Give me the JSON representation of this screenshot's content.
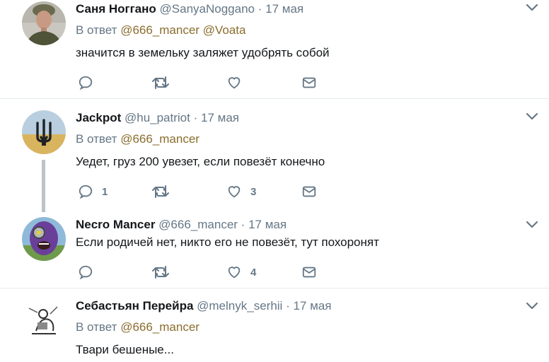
{
  "tweets": [
    {
      "name": "Саня Ногганo",
      "handle": "@SanyaNoggano",
      "sep": "·",
      "date": "17 мая",
      "reply_prefix": "В ответ",
      "reply_mentions": "@666_mancer @Voata",
      "text": "значится в земельку заляжет удобрять собой",
      "reply_count": "",
      "retweet_count": "",
      "like_count": ""
    },
    {
      "name": "Jackpot",
      "handle": "@hu_patriot",
      "sep": "·",
      "date": "17 мая",
      "reply_prefix": "В ответ",
      "reply_mentions": "@666_mancer",
      "text": "Уедет, груз 200 увезет, если повезёт конечно",
      "reply_count": "1",
      "retweet_count": "",
      "like_count": "3"
    },
    {
      "name": "Necro Mancer",
      "handle": "@666_mancer",
      "sep": "·",
      "date": "17 мая",
      "text": "Если родичей нет, никто его не повезёт, тут похоронят",
      "reply_count": "",
      "retweet_count": "",
      "like_count": "4"
    },
    {
      "name": "Себастьян Перейра",
      "handle": "@melnyk_serhii",
      "sep": "·",
      "date": "17 мая",
      "reply_prefix": "В ответ",
      "reply_mentions": "@666_mancer",
      "text": "Твари бешеные..."
    }
  ],
  "colors": {
    "name": "#14171a",
    "meta": "#657786",
    "mention": "#8a6d2e",
    "divider": "#e6ecf0",
    "icon": "#657786"
  },
  "icons": {
    "menu": "chevron-down-icon",
    "reply": "reply-icon",
    "retweet": "retweet-icon",
    "like": "heart-icon",
    "message": "envelope-icon"
  }
}
